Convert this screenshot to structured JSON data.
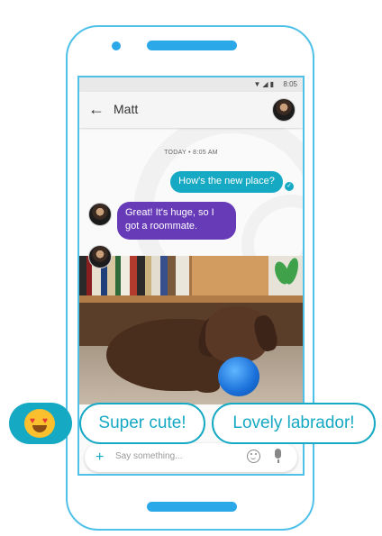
{
  "status_bar": {
    "time": "8:05",
    "icons": [
      "wifi-icon",
      "signal-icon",
      "battery-icon"
    ]
  },
  "app_bar": {
    "contact_name": "Matt"
  },
  "conversation": {
    "date_separator": "TODAY • 8:05 AM",
    "messages": [
      {
        "from": "me",
        "text": "How's the new place?"
      },
      {
        "from": "Matt",
        "text": "Great! It's huge, so I got a roommate."
      }
    ]
  },
  "compose": {
    "placeholder": "Say something..."
  },
  "smart_replies": [
    "Super cute!",
    "Lovely labrador!"
  ],
  "colors": {
    "accent": "#16a9c4",
    "incoming_bubble": "#673ab7",
    "frame": "#4fc1e9"
  }
}
